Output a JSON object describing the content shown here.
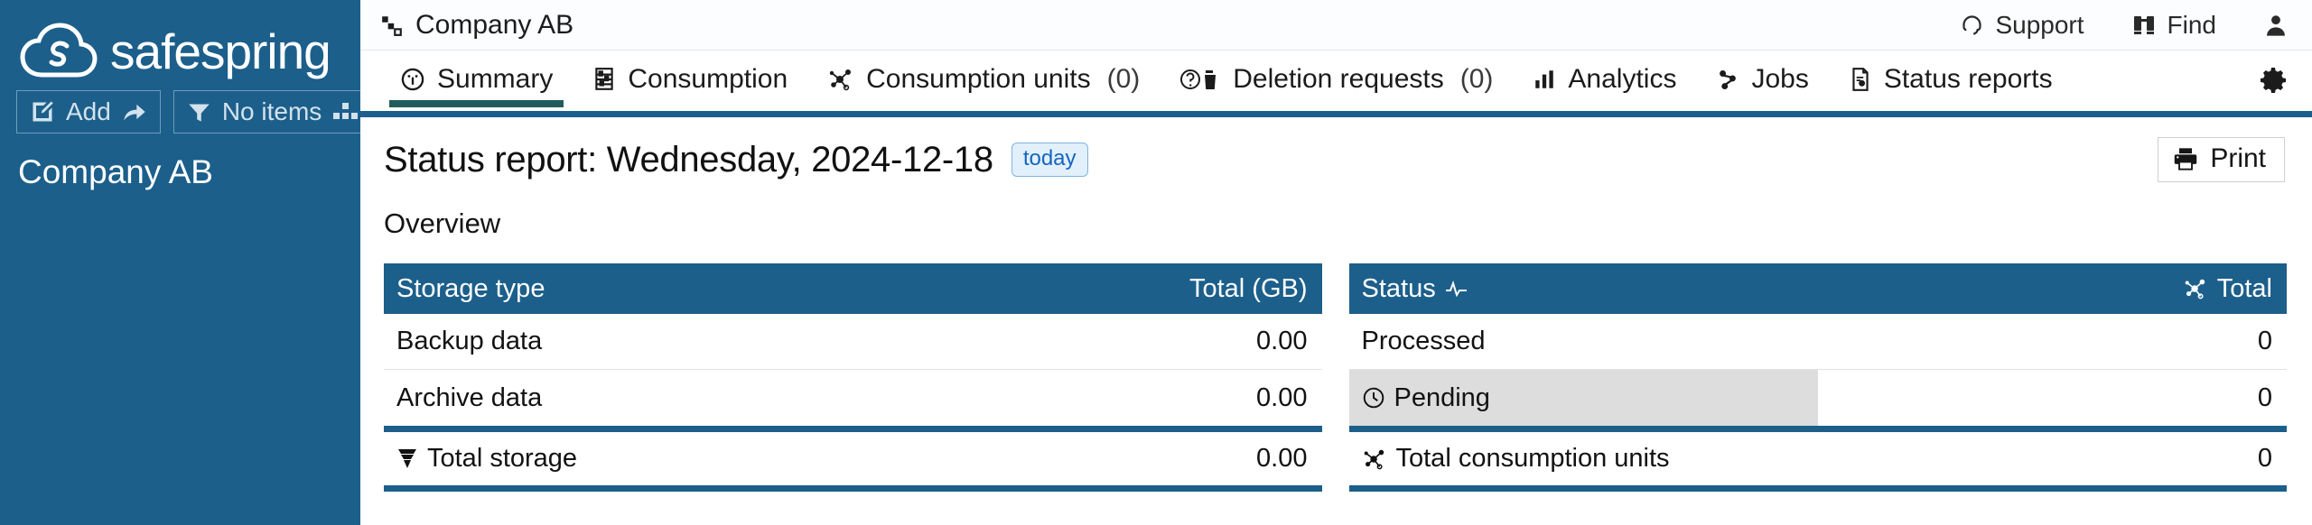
{
  "sidebar": {
    "logo_text": "safespring",
    "logo_icon": "cloud-s-logo",
    "buttons": [
      {
        "label": "Add",
        "icon": "note-edit-icon",
        "trailing_icon": "share-arrow-icon"
      },
      {
        "label": "No items",
        "icon": "funnel-filter-icon",
        "trailing_icon": "grid-nodes-icon"
      }
    ],
    "company": "Company AB"
  },
  "topbar": {
    "breadcrumb": "Company AB",
    "breadcrumb_icon": "hierarchy-node-icon",
    "support": "Support",
    "support_icon": "headset-icon",
    "find": "Find",
    "find_icon": "binoculars-icon",
    "account_icon": "user-avatar-icon"
  },
  "tabs": [
    {
      "label": "Summary",
      "icon": "gauge-icon",
      "count": "",
      "active": true
    },
    {
      "label": "Consumption",
      "icon": "abacus-icon",
      "count": "",
      "active": false
    },
    {
      "label": "Consumption units",
      "icon": "molecule-icon",
      "count": "(0)",
      "active": false
    },
    {
      "label": "Deletion requests",
      "icon": "question-trash-icon",
      "count": "(0)",
      "active": false
    },
    {
      "label": "Analytics",
      "icon": "bar-chart-icon",
      "count": "",
      "active": false
    },
    {
      "label": "Jobs",
      "icon": "jobs-node-icon",
      "count": "",
      "active": false
    },
    {
      "label": "Status reports",
      "icon": "document-report-icon",
      "count": "",
      "active": false
    }
  ],
  "settings_icon": "gear-icon",
  "report": {
    "title": "Status report: Wednesday, 2024-12-18",
    "today_chip": "today",
    "print_label": "Print",
    "print_icon": "printer-icon",
    "overview_label": "Overview"
  },
  "storage_table": {
    "header_left": "Storage type",
    "header_right": "Total (GB)",
    "rows": [
      {
        "label": "Backup data",
        "value": "0.00",
        "icon": ""
      },
      {
        "label": "Archive data",
        "value": "0.00",
        "icon": ""
      }
    ],
    "total": {
      "label": "Total storage",
      "value": "0.00",
      "icon": "storage-stack-icon"
    }
  },
  "status_table": {
    "header_left": "Status",
    "header_left_icon": "pulse-icon",
    "header_right": "Total",
    "header_right_icon": "molecule-icon",
    "rows": [
      {
        "label": "Processed",
        "value": "0",
        "icon": "",
        "bar_percent": 0
      },
      {
        "label": "Pending",
        "value": "0",
        "icon": "clock-icon",
        "bar_percent": 50
      }
    ],
    "total": {
      "label": "Total consumption units",
      "value": "0",
      "icon": "molecule-icon"
    }
  },
  "colors": {
    "brand_blue": "#1c5f8b",
    "accent_teal": "#215c5c",
    "chip_blue": "#1565c0",
    "bar_grey": "#dddddd"
  }
}
